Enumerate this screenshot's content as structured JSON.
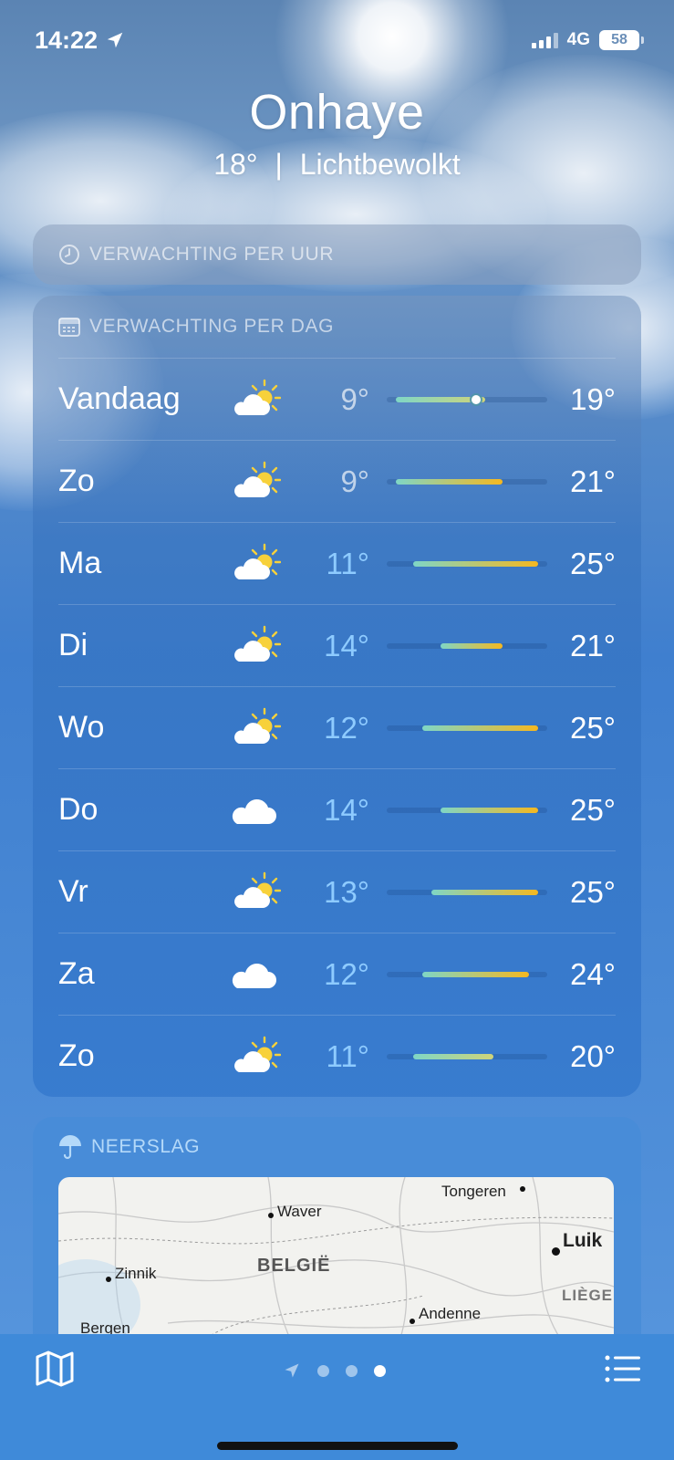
{
  "status_bar": {
    "time": "14:22",
    "network": "4G",
    "battery": "58"
  },
  "header": {
    "city": "Onhaye",
    "temperature": "18°",
    "separator": "|",
    "condition": "Lichtbewolkt"
  },
  "hourly": {
    "title": "VERWACHTING PER UUR",
    "icon": "clock-icon"
  },
  "daily": {
    "title": "VERWACHTING PER DAG",
    "icon": "calendar-icon",
    "days": [
      {
        "day": "Vandaag",
        "icon": "partly-sunny-icon",
        "low": "9°",
        "high": "19°",
        "low_value": 9,
        "high_value": 19,
        "current_value": 18,
        "low_color": "dim"
      },
      {
        "day": "Zo",
        "icon": "partly-sunny-icon",
        "low": "9°",
        "high": "21°",
        "low_value": 9,
        "high_value": 21,
        "low_color": "dim"
      },
      {
        "day": "Ma",
        "icon": "partly-sunny-icon",
        "low": "11°",
        "high": "25°",
        "low_value": 11,
        "high_value": 25,
        "low_color": "blue"
      },
      {
        "day": "Di",
        "icon": "partly-sunny-icon",
        "low": "14°",
        "high": "21°",
        "low_value": 14,
        "high_value": 21,
        "low_color": "blue"
      },
      {
        "day": "Wo",
        "icon": "partly-sunny-icon",
        "low": "12°",
        "high": "25°",
        "low_value": 12,
        "high_value": 25,
        "low_color": "blue"
      },
      {
        "day": "Do",
        "icon": "cloud-icon",
        "low": "14°",
        "high": "25°",
        "low_value": 14,
        "high_value": 25,
        "low_color": "blue"
      },
      {
        "day": "Vr",
        "icon": "partly-sunny-icon",
        "low": "13°",
        "high": "25°",
        "low_value": 13,
        "high_value": 25,
        "low_color": "blue"
      },
      {
        "day": "Za",
        "icon": "cloud-icon",
        "low": "12°",
        "high": "24°",
        "low_value": 12,
        "high_value": 24,
        "low_color": "blue"
      },
      {
        "day": "Zo",
        "icon": "partly-sunny-icon",
        "low": "11°",
        "high": "20°",
        "low_value": 11,
        "high_value": 20,
        "low_color": "blue"
      }
    ]
  },
  "precipitation": {
    "title": "NEERSLAG",
    "icon": "umbrella-icon",
    "map_labels": {
      "waver": "Waver",
      "tongeren": "Tongeren",
      "luik": "Luik",
      "belgie": "BELGIË",
      "zinnik": "Zinnik",
      "liege": "LIÈGE",
      "andenne": "Andenne",
      "bergen": "Bergen"
    }
  },
  "tab_bar": {
    "left_icon": "map-icon",
    "right_icon": "list-icon",
    "pages": 3,
    "active_page": 3
  },
  "colors": {
    "cool": "#7fd6c6",
    "mid": "#cfd47a",
    "warm": "#f5b820"
  }
}
